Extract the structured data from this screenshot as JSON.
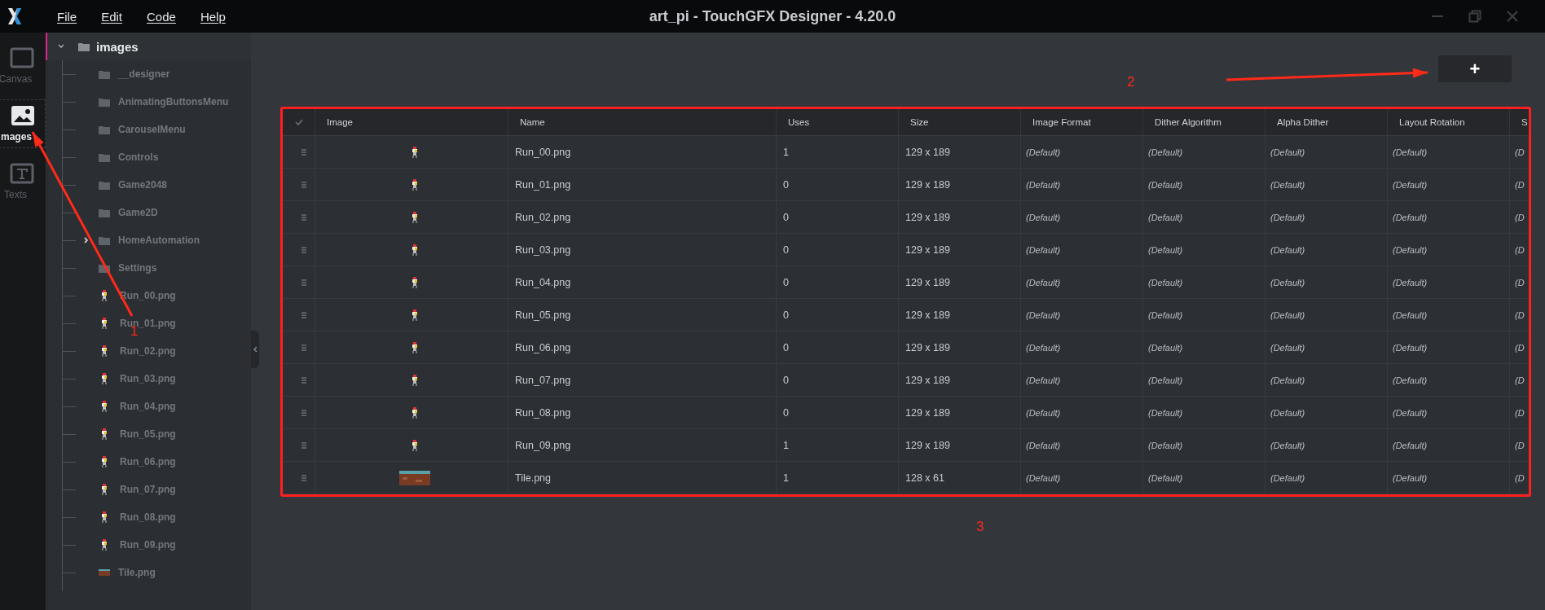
{
  "window": {
    "title": "art_pi - TouchGFX Designer - 4.20.0"
  },
  "menu": [
    "File",
    "Edit",
    "Code",
    "Help"
  ],
  "rail": [
    {
      "label": "Canvas",
      "kind": "canvas",
      "selected": false
    },
    {
      "label": "mages",
      "kind": "images",
      "selected": true
    },
    {
      "label": "Texts",
      "kind": "texts",
      "selected": false
    }
  ],
  "tree": {
    "label": "images",
    "kind": "folder",
    "expanded": true,
    "children": [
      {
        "label": "__designer",
        "kind": "folder"
      },
      {
        "label": "AnimatingButtonsMenu",
        "kind": "folder"
      },
      {
        "label": "CarouselMenu",
        "kind": "folder"
      },
      {
        "label": "Controls",
        "kind": "folder"
      },
      {
        "label": "Game2048",
        "kind": "folder"
      },
      {
        "label": "Game2D",
        "kind": "folder"
      },
      {
        "label": "HomeAutomation",
        "kind": "folder",
        "expanded": false
      },
      {
        "label": "Settings",
        "kind": "folder"
      },
      {
        "label": "Run_00.png",
        "kind": "sprite"
      },
      {
        "label": "Run_01.png",
        "kind": "sprite"
      },
      {
        "label": "Run_02.png",
        "kind": "sprite"
      },
      {
        "label": "Run_03.png",
        "kind": "sprite"
      },
      {
        "label": "Run_04.png",
        "kind": "sprite"
      },
      {
        "label": "Run_05.png",
        "kind": "sprite"
      },
      {
        "label": "Run_06.png",
        "kind": "sprite"
      },
      {
        "label": "Run_07.png",
        "kind": "sprite"
      },
      {
        "label": "Run_08.png",
        "kind": "sprite"
      },
      {
        "label": "Run_09.png",
        "kind": "sprite"
      },
      {
        "label": "Tile.png",
        "kind": "tile"
      }
    ]
  },
  "add_button": {
    "label": "+"
  },
  "table": {
    "select_all_checked": false,
    "image_header": "Image",
    "columns": [
      "Name",
      "Uses",
      "Size",
      "Image Format",
      "Dither Algorithm",
      "Alpha Dither",
      "Layout Rotation",
      "S"
    ],
    "rows": [
      {
        "kind": "sprite",
        "cells": [
          "Run_00.png",
          "1",
          "129 x 189",
          "(Default)",
          "(Default)",
          "(Default)",
          "(Default)",
          "(D"
        ]
      },
      {
        "kind": "sprite",
        "cells": [
          "Run_01.png",
          "0",
          "129 x 189",
          "(Default)",
          "(Default)",
          "(Default)",
          "(Default)",
          "(D"
        ]
      },
      {
        "kind": "sprite",
        "cells": [
          "Run_02.png",
          "0",
          "129 x 189",
          "(Default)",
          "(Default)",
          "(Default)",
          "(Default)",
          "(D"
        ]
      },
      {
        "kind": "sprite",
        "cells": [
          "Run_03.png",
          "0",
          "129 x 189",
          "(Default)",
          "(Default)",
          "(Default)",
          "(Default)",
          "(D"
        ]
      },
      {
        "kind": "sprite",
        "cells": [
          "Run_04.png",
          "0",
          "129 x 189",
          "(Default)",
          "(Default)",
          "(Default)",
          "(Default)",
          "(D"
        ]
      },
      {
        "kind": "sprite",
        "cells": [
          "Run_05.png",
          "0",
          "129 x 189",
          "(Default)",
          "(Default)",
          "(Default)",
          "(Default)",
          "(D"
        ]
      },
      {
        "kind": "sprite",
        "cells": [
          "Run_06.png",
          "0",
          "129 x 189",
          "(Default)",
          "(Default)",
          "(Default)",
          "(Default)",
          "(D"
        ]
      },
      {
        "kind": "sprite",
        "cells": [
          "Run_07.png",
          "0",
          "129 x 189",
          "(Default)",
          "(Default)",
          "(Default)",
          "(Default)",
          "(D"
        ]
      },
      {
        "kind": "sprite",
        "cells": [
          "Run_08.png",
          "0",
          "129 x 189",
          "(Default)",
          "(Default)",
          "(Default)",
          "(Default)",
          "(D"
        ]
      },
      {
        "kind": "sprite",
        "cells": [
          "Run_09.png",
          "1",
          "129 x 189",
          "(Default)",
          "(Default)",
          "(Default)",
          "(Default)",
          "(D"
        ]
      },
      {
        "kind": "tile",
        "cells": [
          "Tile.png",
          "1",
          "128 x 61",
          "(Default)",
          "(Default)",
          "(Default)",
          "(Default)",
          "(D"
        ]
      }
    ]
  },
  "annotations": [
    {
      "label": "1",
      "arrow": true
    },
    {
      "label": "2",
      "arrow": true
    },
    {
      "label": "3",
      "arrow": false
    }
  ]
}
